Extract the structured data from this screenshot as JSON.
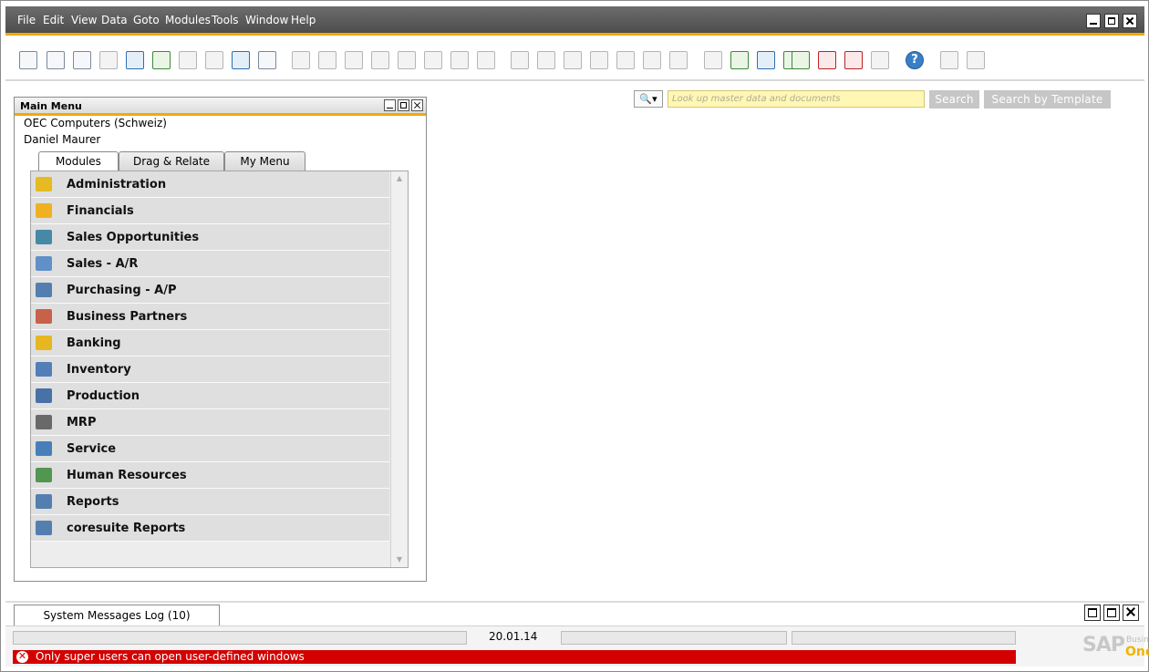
{
  "menubar": {
    "items": [
      "File",
      "Edit",
      "View",
      "Data",
      "Goto",
      "Modules",
      "Tools",
      "Window",
      "Help"
    ]
  },
  "toolbar": {
    "icons": [
      "preview-icon",
      "print-icon",
      "email-icon",
      "sms-icon",
      "fax-icon",
      "export-excel-icon",
      "export-word-icon",
      "export-pdf-icon",
      "launch-application-icon",
      "lock-screen-icon",
      "find-icon",
      "add-icon",
      "first-record-icon",
      "previous-record-icon",
      "next-record-icon",
      "last-record-icon",
      "filter-icon",
      "sort-icon",
      "base-document-icon",
      "target-document-icon",
      "gross-profit-icon",
      "payment-means-icon",
      "volume-weight-icon",
      "journal-entry-icon",
      "settings-icon",
      "edit-icon",
      "user-defined-icon",
      "database-icon",
      "tools-icon",
      "calendar-check-icon",
      "message-icon",
      "calendar-icon",
      "structure-icon",
      "help-icon",
      "form-settings-icon",
      "document-settings-icon"
    ]
  },
  "search": {
    "scope_symbol": "🔍▾",
    "placeholder": "Look up master data and documents",
    "search_label": "Search",
    "template_label": "Search by Template"
  },
  "main_menu": {
    "title": "Main Menu",
    "company": "OEC Computers (Schweiz)",
    "user": "Daniel Maurer",
    "tabs": [
      {
        "label": "Modules",
        "active": true
      },
      {
        "label": "Drag & Relate",
        "active": false
      },
      {
        "label": "My Menu",
        "active": false
      }
    ],
    "modules": [
      {
        "label": "Administration",
        "icon": "administration-icon",
        "color": "#e8b400"
      },
      {
        "label": "Financials",
        "icon": "financials-icon",
        "color": "#f2a900"
      },
      {
        "label": "Sales Opportunities",
        "icon": "sales-opportunities-icon",
        "color": "#2a7a9c"
      },
      {
        "label": "Sales - A/R",
        "icon": "sales-icon",
        "color": "#4a82c4"
      },
      {
        "label": "Purchasing - A/P",
        "icon": "purchasing-icon",
        "color": "#3a6ea8"
      },
      {
        "label": "Business Partners",
        "icon": "business-partners-icon",
        "color": "#c44b2f"
      },
      {
        "label": "Banking",
        "icon": "banking-icon",
        "color": "#e8b000"
      },
      {
        "label": "Inventory",
        "icon": "inventory-icon",
        "color": "#3a6fb0"
      },
      {
        "label": "Production",
        "icon": "production-icon",
        "color": "#2e5f9c"
      },
      {
        "label": "MRP",
        "icon": "mrp-icon",
        "color": "#555555"
      },
      {
        "label": "Service",
        "icon": "service-icon",
        "color": "#2f6fb3"
      },
      {
        "label": "Human Resources",
        "icon": "human-resources-icon",
        "color": "#3a8a3a"
      },
      {
        "label": "Reports",
        "icon": "reports-icon",
        "color": "#3a6ea8"
      },
      {
        "label": "coresuite Reports",
        "icon": "coresuite-reports-icon",
        "color": "#3a6ea8"
      }
    ]
  },
  "system_messages": {
    "tab_label": "System Messages Log (10)"
  },
  "status": {
    "date": "20.01.14",
    "error_message": "Only super users can open user-defined windows"
  },
  "logo": {
    "sap": "SAP",
    "business": "Business",
    "one": "One"
  }
}
